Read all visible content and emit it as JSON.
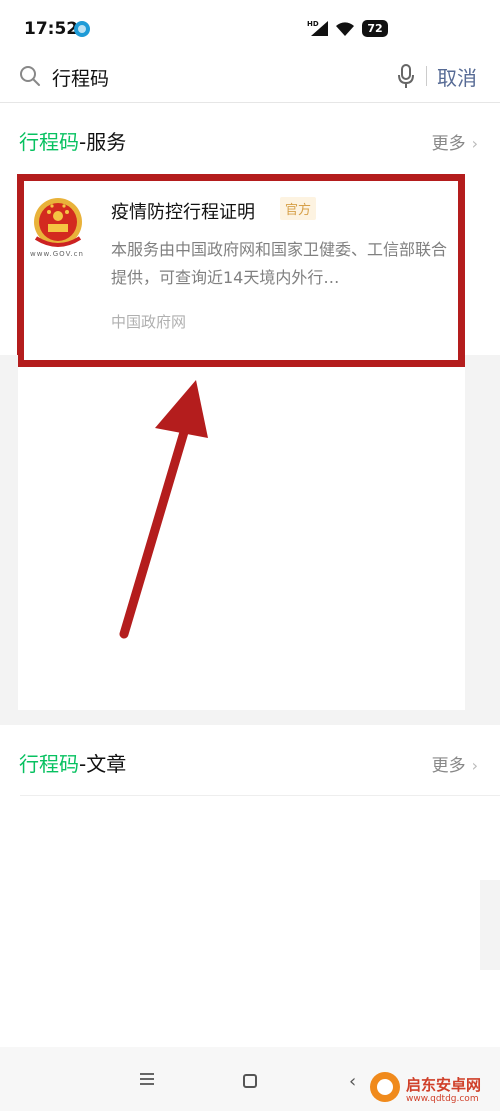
{
  "status_bar": {
    "time": "17:52",
    "battery": "72",
    "icons": [
      "hd-signal-icon",
      "wifi-icon",
      "battery-icon"
    ]
  },
  "search": {
    "query": "行程码",
    "cancel_label": "取消"
  },
  "services_section": {
    "title_highlight": "行程码",
    "title_suffix": "-服务",
    "more_label": "更多",
    "card": {
      "title": "疫情防控行程证明",
      "badge": "官方",
      "description": "本服务由中国政府网和国家卫健委、工信部联合提供，可查询近14天境内外行…",
      "source": "中国政府网",
      "logo_text": "www.GOV.cn"
    }
  },
  "articles_section": {
    "title_highlight": "行程码",
    "title_suffix": "-文章",
    "more_label": "更多"
  },
  "watermark": {
    "name": "启东安卓网",
    "url": "www.qdtdg.com"
  },
  "colors": {
    "highlight": "#07c160",
    "cancel": "#576b95",
    "annotation": "#b41d1d",
    "badge_text": "#d6a04a"
  }
}
